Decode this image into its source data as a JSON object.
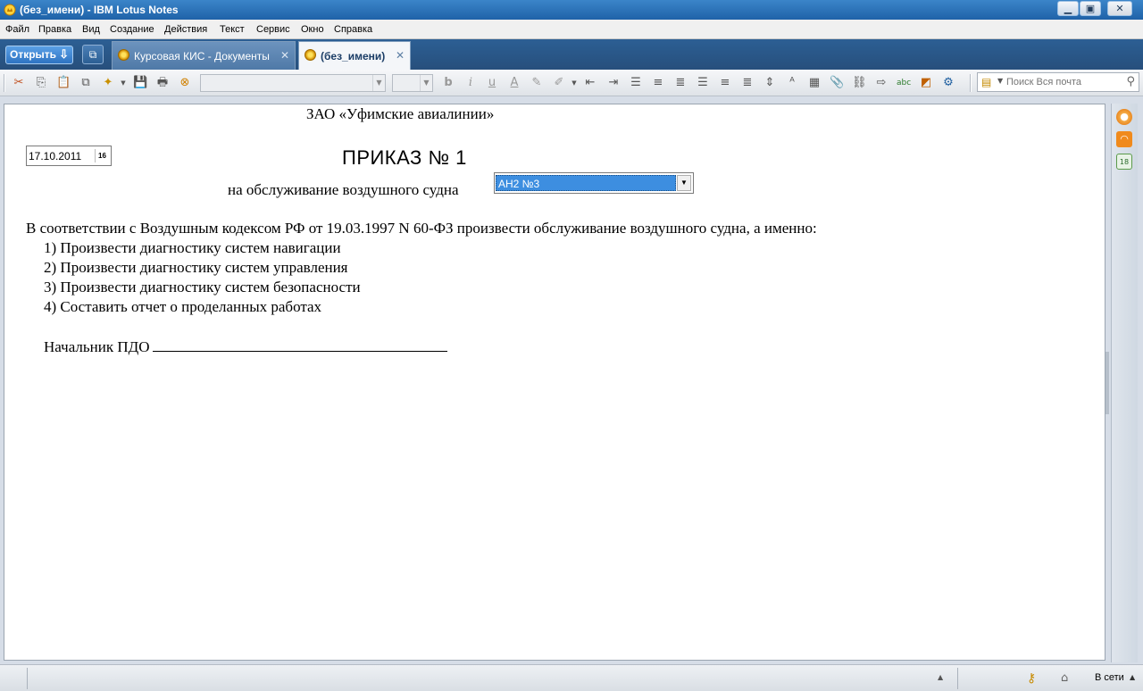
{
  "window": {
    "title": "(без_имени) - IBM Lotus Notes",
    "minimize": "▁",
    "maximize": "▣",
    "close": "✕"
  },
  "menu": [
    "Файл",
    "Правка",
    "Вид",
    "Создание",
    "Действия",
    "Текст",
    "Сервис",
    "Окно",
    "Справка"
  ],
  "tabs": {
    "open_label": "Открыть",
    "items": [
      {
        "label": "Курсовая КИС - Документы",
        "active": false
      },
      {
        "label": "(без_имени)",
        "active": true
      }
    ]
  },
  "toolbar": {
    "font_name": "",
    "font_size": "",
    "search_placeholder": "Поиск Вся почта"
  },
  "document": {
    "company": "ЗАО  «Уфимские авиалинии»",
    "date": "17.10.2011",
    "calendar_label": "16",
    "title": "ПРИКАЗ № 1",
    "subtitle": "на обслуживание воздушного судна",
    "aircraft": "АН2 №3",
    "intro": "В соответствии с Воздушным кодексом РФ от 19.03.1997 N 60-ФЗ произвести обслуживание воздушного судна, а именно:",
    "items": [
      "1) Произвести диагностику систем навигации",
      "2) Произвести диагностику систем управления",
      "3) Произвести диагностику систем безопасности",
      "4) Составить отчет о проделанных работах"
    ],
    "signature": "Начальник ПДО"
  },
  "statusbar": {
    "status": "В сети"
  },
  "colors": {
    "titlebar": "#1f62a8",
    "tabbar": "#274f7c",
    "selection": "#3d8ee0"
  }
}
